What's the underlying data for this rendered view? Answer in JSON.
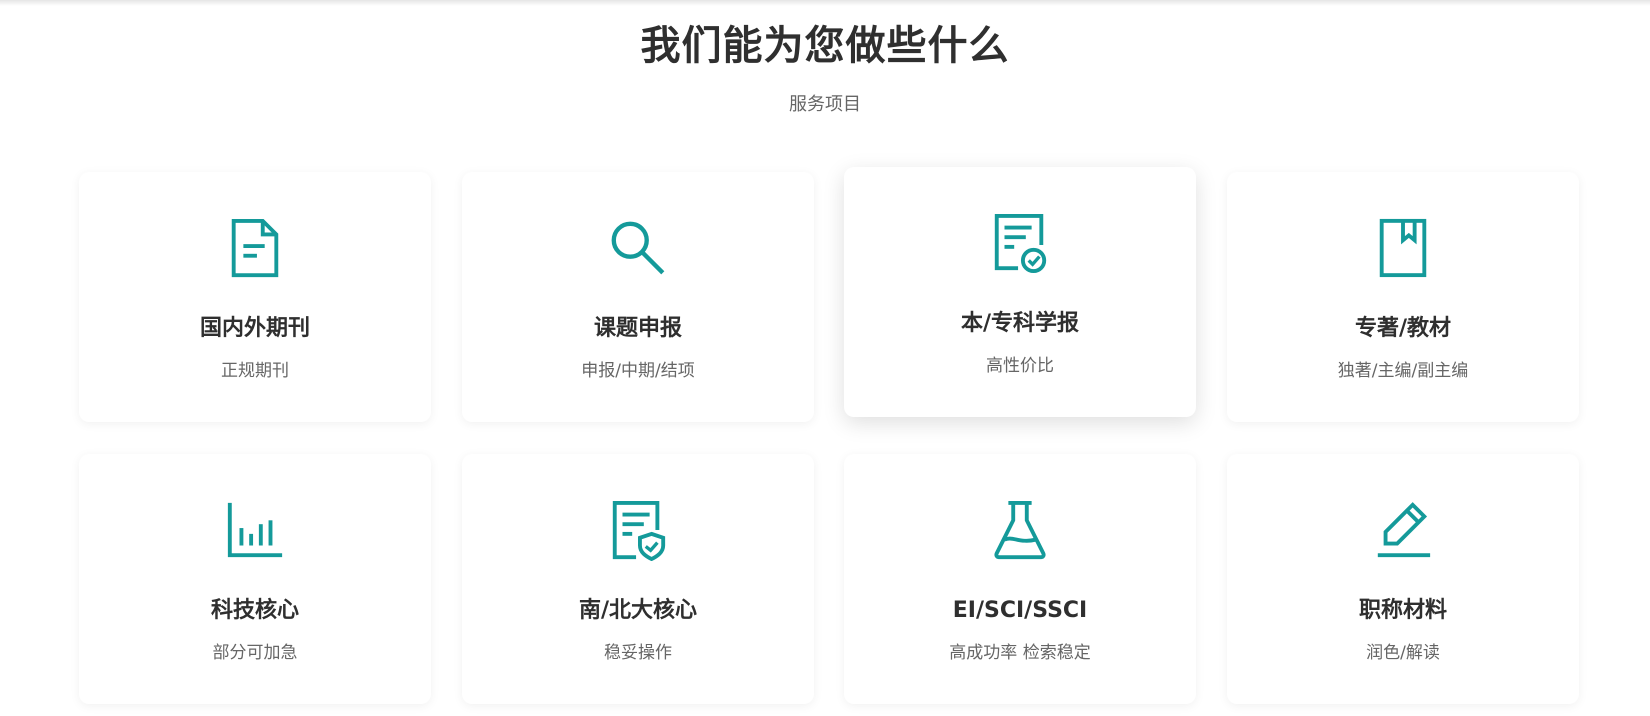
{
  "header": {
    "title": "我们能为您做些什么",
    "subtitle": "服务项目"
  },
  "theme": {
    "accent": "#149a9a",
    "text_dark": "#2f2f2f",
    "text_muted": "#666666"
  },
  "services": [
    {
      "title": "国内外期刊",
      "desc": "正规期刊",
      "icon": "document-icon"
    },
    {
      "title": "课题申报",
      "desc": "申报/中期/结项",
      "icon": "search-icon"
    },
    {
      "title": "本/专科学报",
      "desc": "高性价比",
      "icon": "certificate-icon"
    },
    {
      "title": "专著/教材",
      "desc": "独著/主编/副主编",
      "icon": "book-icon"
    },
    {
      "title": "科技核心",
      "desc": "部分可加急",
      "icon": "bar-chart-icon"
    },
    {
      "title": "南/北大核心",
      "desc": "稳妥操作",
      "icon": "document-shield-icon"
    },
    {
      "title": "EI/SCI/SSCI",
      "desc": "高成功率 检索稳定",
      "icon": "flask-icon"
    },
    {
      "title": "职称材料",
      "desc": "润色/解读",
      "icon": "pen-icon"
    }
  ]
}
